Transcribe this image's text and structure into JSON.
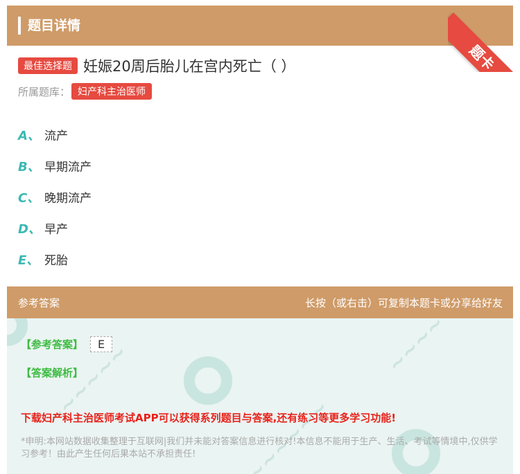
{
  "header": {
    "title": "题目详情",
    "ribbon_label": "题卡"
  },
  "question": {
    "type_badge": "最佳选择题",
    "text": "妊娠20周后胎儿在宫内死亡（ ）",
    "bank_label": "所属题库：",
    "bank_tag": "妇产科主治医师"
  },
  "options": [
    {
      "letter": "A、",
      "text": "流产"
    },
    {
      "letter": "B、",
      "text": "早期流产"
    },
    {
      "letter": "C、",
      "text": "晚期流产"
    },
    {
      "letter": "D、",
      "text": "早产"
    },
    {
      "letter": "E、",
      "text": "死胎"
    }
  ],
  "answer_section": {
    "title": "参考答案",
    "hint": "长按（或右击）可复制本题卡或分享给好友",
    "answer_label": "【参考答案】",
    "answer_value": "E",
    "analysis_label": "【答案解析】",
    "promo": "下载妇产科主治医师考试APP可以获得系列题目与答案,还有练习等更多学习功能!",
    "disclaimer": "*申明:本网站数据收集整理于互联网|我们并未能对答案信息进行核对!本信息不能用于生产、生活、考试等情境中,仅供学习参考！由此产生任何后果本站不承担责任!"
  },
  "colors": {
    "header": "#cf9b68",
    "accent_red": "#e64a40",
    "option_letter": "#3bb9b3",
    "answer_green": "#3dbb42",
    "promo_red": "#e8221b"
  }
}
